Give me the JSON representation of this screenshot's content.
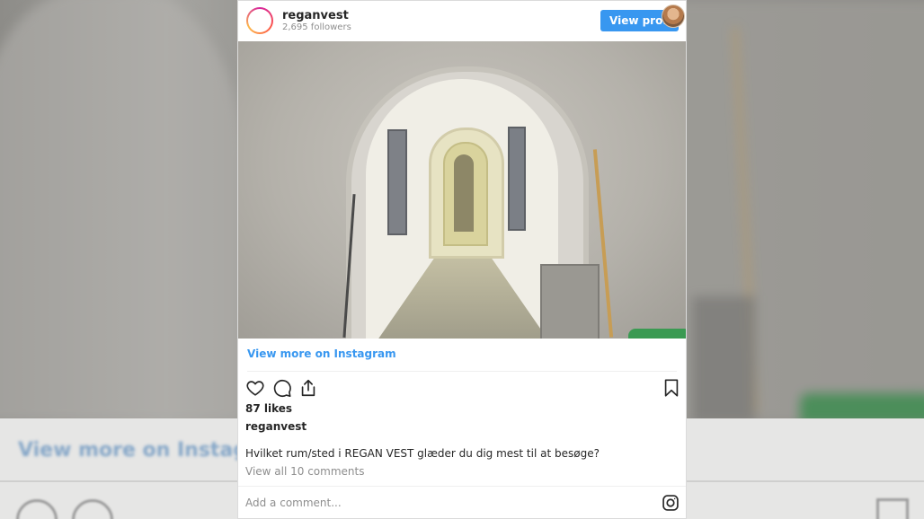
{
  "profile": {
    "username": "reganvest",
    "followers": "2,695 followers",
    "view_profile_label": "View profile"
  },
  "post": {
    "image_alt": "Underground bunker tunnel with arched corridor",
    "view_more_label": "View more on Instagram",
    "likes": "87 likes",
    "owner": "reganvest",
    "caption": "Hvilket rum/sted i REGAN VEST glæder du dig mest til at besøge?",
    "view_comments": "View all 10 comments",
    "add_comment_placeholder": "Add a comment..."
  },
  "background": {
    "ghost_link": "View more on Instag"
  },
  "icons": {
    "like": "heart-icon",
    "comment": "comment-icon",
    "share": "share-icon",
    "save": "bookmark-icon",
    "logo": "instagram-icon"
  },
  "colors": {
    "accent": "#3897f0",
    "text": "#262626",
    "muted": "#8e8e8e"
  }
}
